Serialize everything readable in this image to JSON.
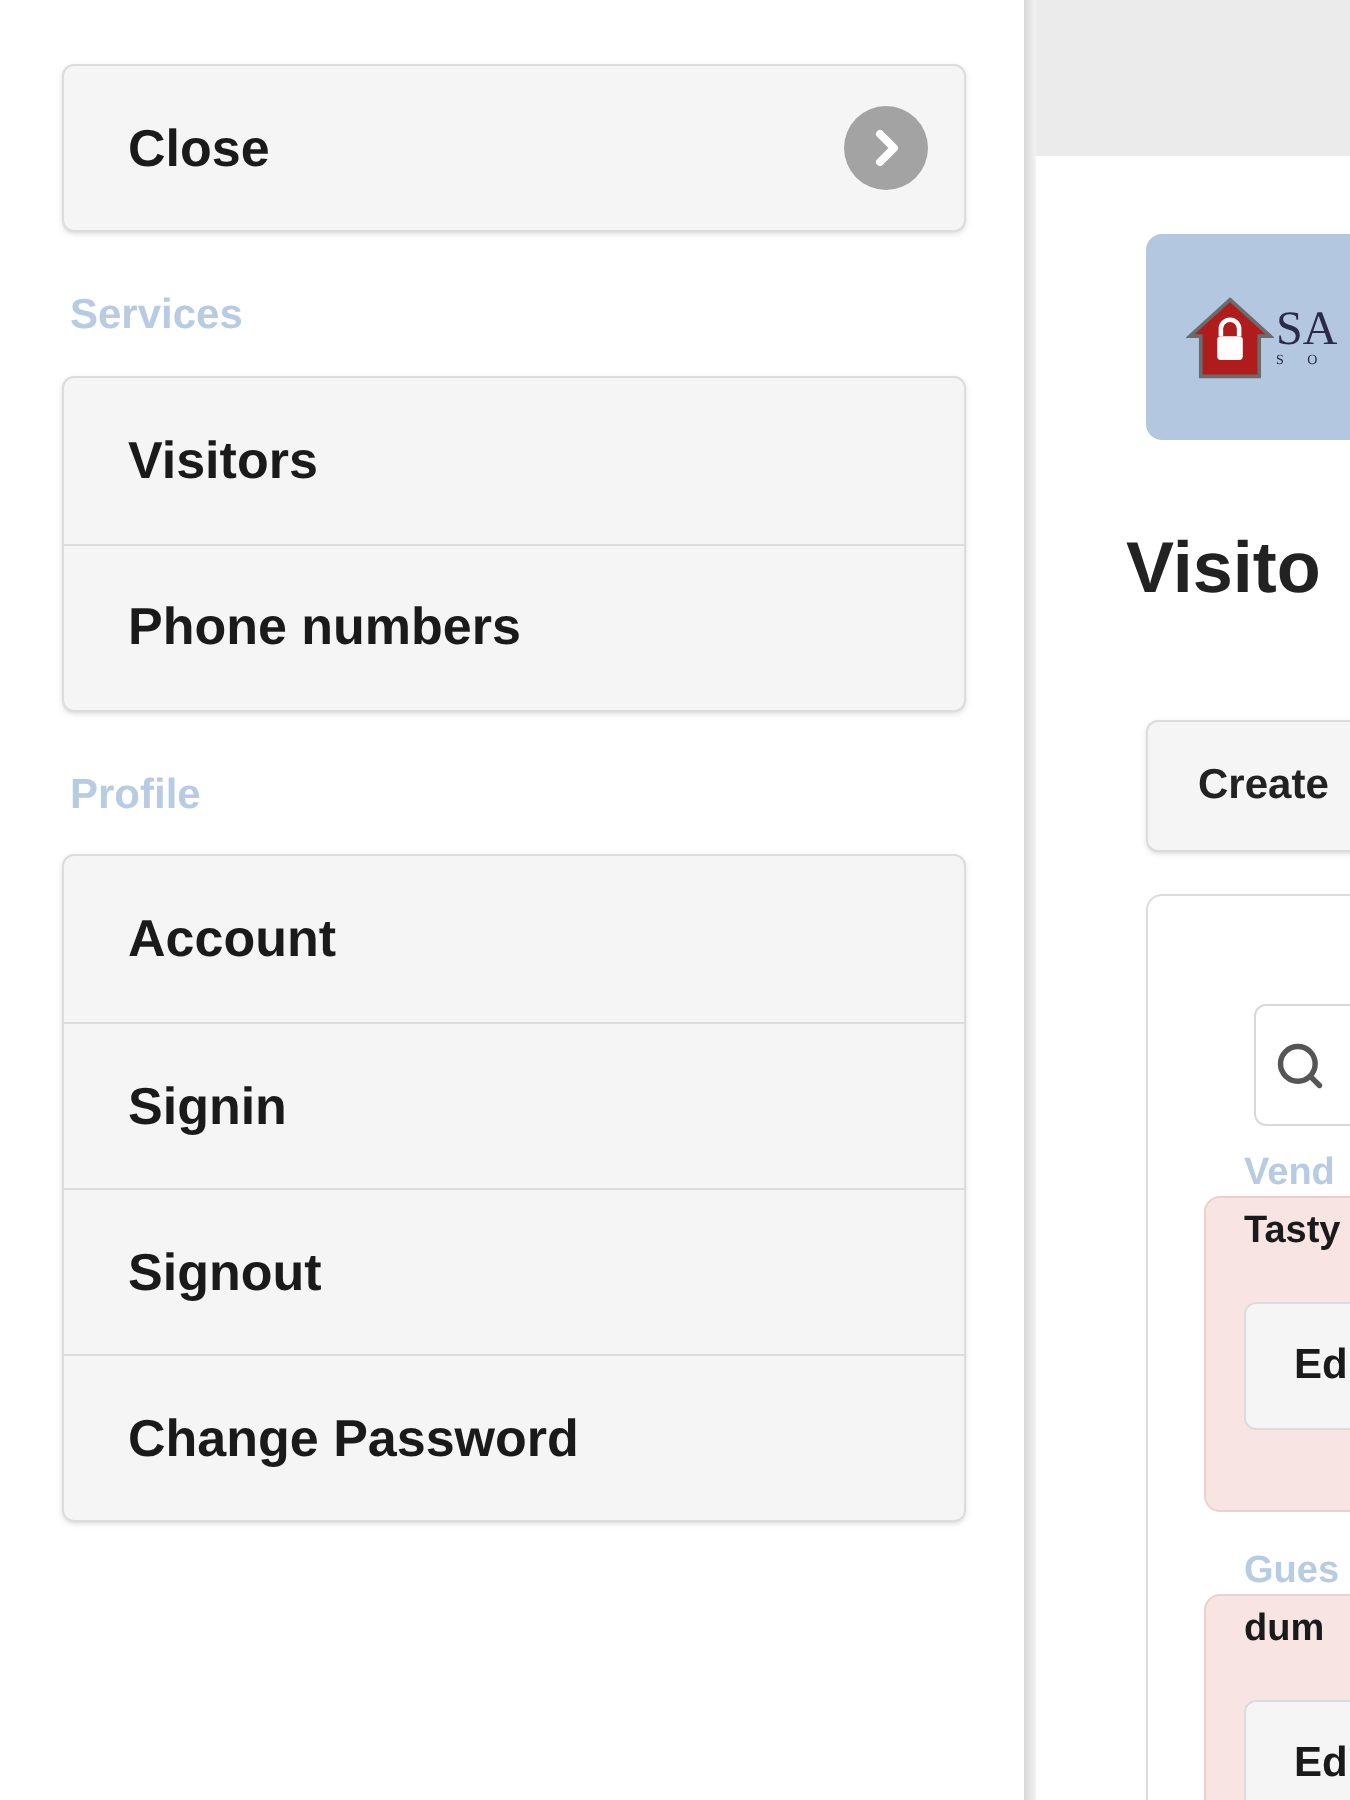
{
  "menu": {
    "close": {
      "label": "Close"
    },
    "sections": [
      {
        "title": "Services",
        "items": [
          {
            "label": "Visitors"
          },
          {
            "label": "Phone numbers"
          }
        ]
      },
      {
        "title": "Profile",
        "items": [
          {
            "label": "Account"
          },
          {
            "label": "Signin"
          },
          {
            "label": "Signout"
          },
          {
            "label": "Change Password"
          }
        ]
      }
    ]
  },
  "page": {
    "logo": {
      "name": "SA",
      "tagline": "S O"
    },
    "heading": "Visito",
    "create_button": "Create",
    "groups": [
      {
        "title": "Vend",
        "entry": "Tasty",
        "button": "Ed"
      },
      {
        "title": "Gues",
        "entry": "dum",
        "button": "Ed"
      }
    ]
  }
}
